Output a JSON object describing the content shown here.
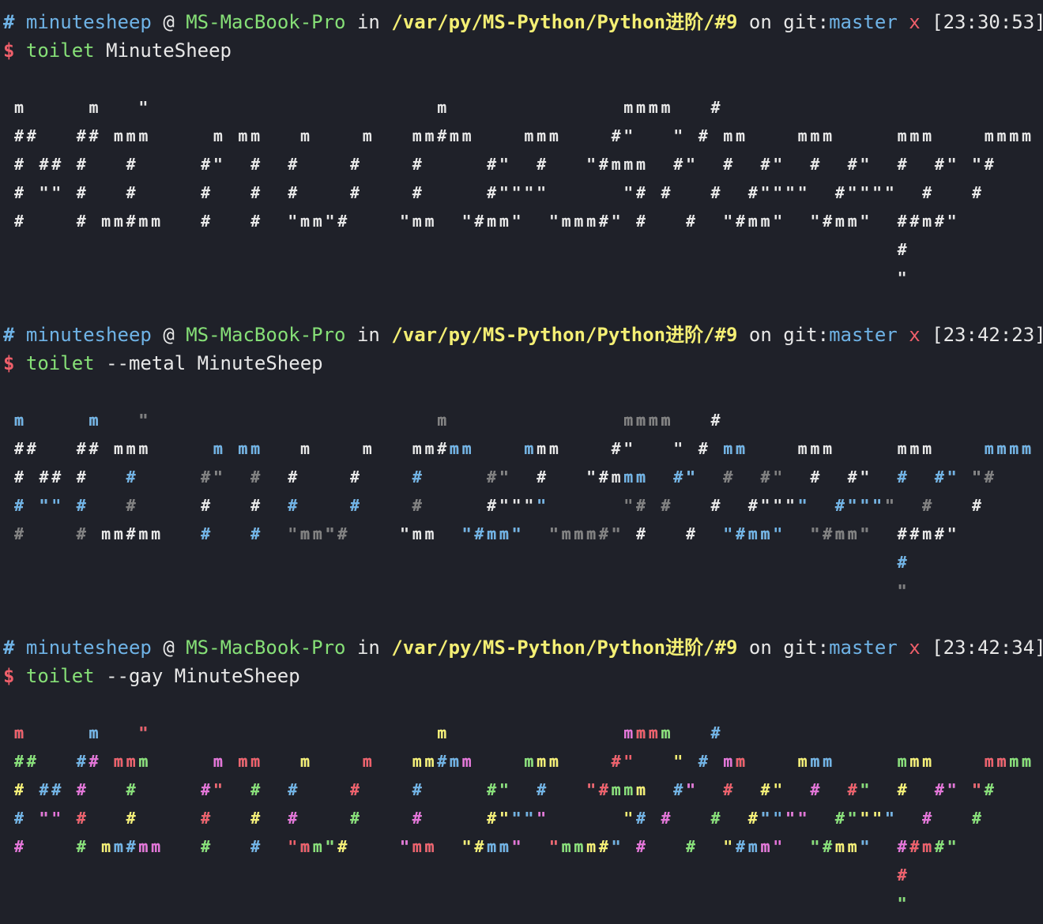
{
  "prompts": [
    {
      "hash": "#",
      "user": "minutesheep",
      "at": "@",
      "host": "MS-MacBook-Pro",
      "in": "in",
      "path": "/var/py/MS-Python/Python进阶/#9",
      "on": "on",
      "git_prefix": "git:",
      "branch": "master",
      "dirty": "x",
      "time": "[23:30:53]",
      "dollar": "$",
      "cmd": "toilet",
      "args": "MinuteSheep"
    },
    {
      "hash": "#",
      "user": "minutesheep",
      "at": "@",
      "host": "MS-MacBook-Pro",
      "in": "in",
      "path": "/var/py/MS-Python/Python进阶/#9",
      "on": "on",
      "git_prefix": "git:",
      "branch": "master",
      "dirty": "x",
      "time": "[23:42:23]",
      "dollar": "$",
      "cmd": "toilet",
      "args": "--metal MinuteSheep"
    },
    {
      "hash": "#",
      "user": "minutesheep",
      "at": "@",
      "host": "MS-MacBook-Pro",
      "in": "in",
      "path": "/var/py/MS-Python/Python进阶/#9",
      "on": "on",
      "git_prefix": "git:",
      "branch": "master",
      "dirty": "x",
      "time": "[23:42:34]",
      "dollar": "$",
      "cmd": "toilet",
      "args": "--gay MinuteSheep"
    }
  ],
  "banner": "m     m   \"                       m              mmmm   #\n##   ## mmm     m mm   m    m   mm#mm    mmm    #\"   \" # mm    mmm     mmm    mmmm\n# ## #   #     #\"  #  #    #    #     #\"  #   \"#mmm  #\"  #  #\"  #  #\"  #  #\" \"#\n# \"\" #   #     #   #  #    #    #     #\"\"\"\"      \"# #   #  #\"\"\"\"  #\"\"\"\"  #   #\n#    # mm#mm   #   #  \"mm\"#    \"mm  \"#mm\"  \"mmm#\" #   #  \"#mm\"  \"#mm\"  ##m#\"\n                                                                       #\n                                                                       \"",
  "colors": {
    "background": "#1f2129",
    "text": "#e8e8e8",
    "blue": "#6fb3e6",
    "green": "#86e077",
    "yellow": "#f4ef74",
    "red": "#ef5f6a",
    "gray": "#808080",
    "magenta": "#e473d9"
  }
}
